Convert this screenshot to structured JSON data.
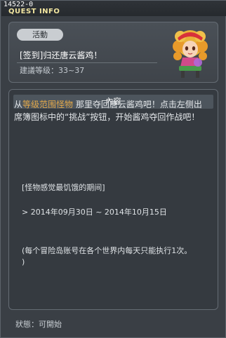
{
  "window": {
    "quest_id": "14522-0",
    "title": "QUEST INFO"
  },
  "info": {
    "tag": "活動",
    "quest_name": "[签到]归还唐云酱鸡！",
    "level_text": "建議等级：33~37"
  },
  "content": {
    "header": "內容",
    "para_prefix": "从",
    "para_highlight": "等级范围怪物",
    "para_line1_rest": " 那里夺回唐云酱鸡吧！点击左侧出",
    "para_line2": "席簿图标中的“挑战”按钮，开始酱鸡夺回作战吧！",
    "period_label": "[怪物感觉最饥饿的期间]",
    "period_dates": "> 2014年09月30日 ~ 2014年10月15日",
    "note_line1": "(每个冒险岛账号在各个世界内每天只能执行1次。",
    "note_line2": ")"
  },
  "status": "狀態：可開始",
  "colors": {
    "highlight": "#e0a74a",
    "title": "#f2e6a0"
  },
  "icons": {
    "avatar": "npc-avatar-icon"
  }
}
